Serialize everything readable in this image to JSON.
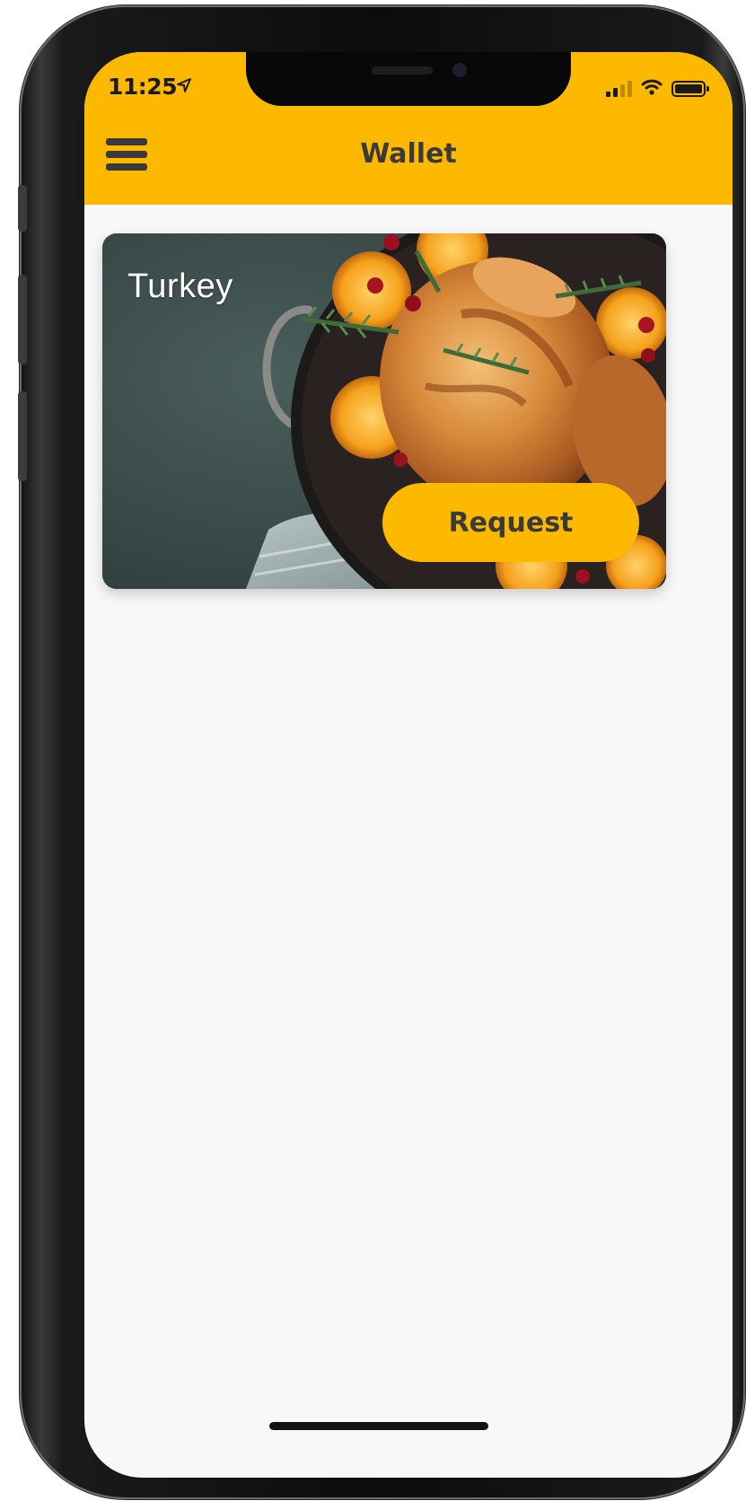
{
  "status_bar": {
    "time": "11:25"
  },
  "header": {
    "title": "Wallet"
  },
  "cards": [
    {
      "title": "Turkey",
      "action_label": "Request"
    }
  ],
  "colors": {
    "accent": "#fdb900",
    "header_text": "#3a3a3a",
    "background": "#f8f8f8"
  },
  "icons": {
    "menu": "hamburger-menu-icon",
    "location": "location-arrow-icon",
    "signal": "cellular-signal-icon",
    "wifi": "wifi-icon",
    "battery": "battery-icon"
  }
}
